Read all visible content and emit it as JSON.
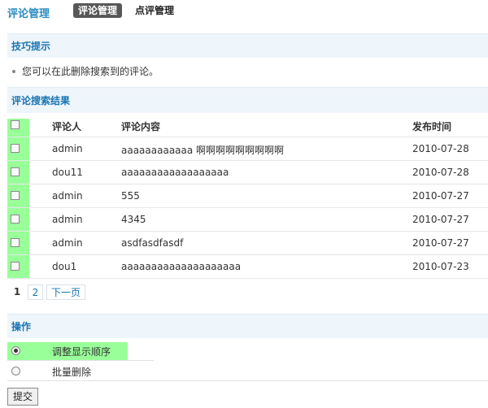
{
  "header": {
    "title": "评论管理",
    "tabs": [
      {
        "label": "评论管理",
        "active": true
      },
      {
        "label": "点评管理",
        "active": false
      }
    ]
  },
  "tips": {
    "title": "技巧提示",
    "text": "您可以在此删除搜索到的评论。"
  },
  "results": {
    "title": "评论搜索结果",
    "columns": [
      "评论人",
      "评论内容",
      "发布时间"
    ],
    "rows": [
      {
        "user": "admin",
        "content": "aaaaaaaaaaaa 啊啊啊啊啊啊啊啊啊",
        "date": "2010-07-28"
      },
      {
        "user": "dou11",
        "content": "aaaaaaaaaaaaaaaaaa",
        "date": "2010-07-28"
      },
      {
        "user": "admin",
        "content": "555",
        "date": "2010-07-27"
      },
      {
        "user": "admin",
        "content": "4345",
        "date": "2010-07-27"
      },
      {
        "user": "admin",
        "content": "asdfasdfasdf",
        "date": "2010-07-27"
      },
      {
        "user": "dou1",
        "content": "aaaaaaaaaaaaaaaaaaaa",
        "date": "2010-07-23"
      }
    ]
  },
  "pager": {
    "current": "1",
    "pages": [
      "2"
    ],
    "next": "下一页"
  },
  "operations": {
    "title": "操作",
    "options": [
      {
        "label": "调整显示顺序",
        "selected": true
      },
      {
        "label": "批量删除",
        "selected": false
      }
    ],
    "submit": "提交"
  }
}
